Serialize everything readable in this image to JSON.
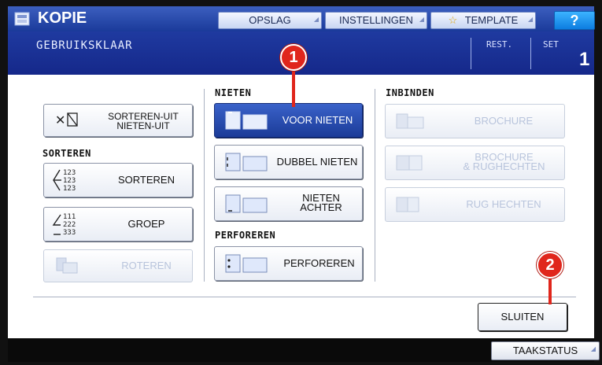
{
  "header": {
    "title": "KOPIE",
    "buttons": [
      {
        "label": "OPSLAG"
      },
      {
        "label": "INSTELLINGEN"
      },
      {
        "label": "TEMPLATE"
      }
    ],
    "help_label": "?"
  },
  "status": {
    "text": "GEBRUIKSKLAAR",
    "rest_label": "REST.",
    "set_label": "SET",
    "set_value": "1"
  },
  "left": {
    "sort_none_label_1": "SORTEREN-UIT",
    "sort_none_label_2": "NIETEN-UIT",
    "sort_section": "SORTEREN",
    "sorteren": "SORTEREN",
    "groep": "GROEP",
    "roteren": "ROTEREN",
    "sort_icon_lines": [
      "123",
      "123",
      "123"
    ],
    "group_icon_lines": [
      "111",
      "222",
      "333"
    ]
  },
  "nieten": {
    "section": "NIETEN",
    "voor": "VOOR NIETEN",
    "dubbel": "DUBBEL NIETEN",
    "achter_1": "NIETEN",
    "achter_2": "ACHTER"
  },
  "perforeren": {
    "section": "PERFOREREN",
    "button": "PERFOREREN"
  },
  "inbinden": {
    "section": "INBINDEN",
    "brochure": "BROCHURE",
    "brochure_rug_1": "BROCHURE",
    "brochure_rug_2": "& RUGHECHTEN",
    "rug": "RUG HECHTEN"
  },
  "footer": {
    "close": "SLUITEN",
    "taakstatus": "TAAKSTATUS"
  },
  "callouts": {
    "one": "1",
    "two": "2"
  },
  "colors": {
    "accent": "#1f3aa0",
    "selected": "#2a4fb8",
    "callout": "#e0261c"
  }
}
